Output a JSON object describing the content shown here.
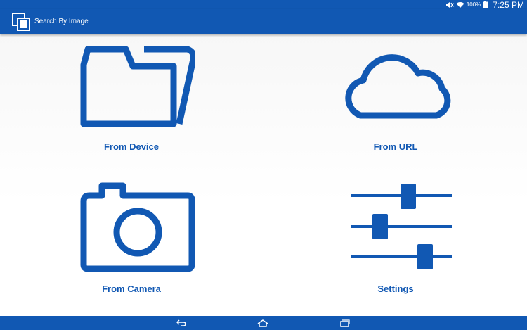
{
  "status_bar": {
    "battery_percent": "100%",
    "time": "7:25 PM",
    "icons": [
      "mute-icon",
      "wifi-icon",
      "battery-icon"
    ]
  },
  "app_bar": {
    "title": "Search By Image",
    "icon": "app-logo-icon"
  },
  "menu": [
    {
      "label": "From Device",
      "icon": "folder-icon"
    },
    {
      "label": "From URL",
      "icon": "cloud-icon"
    },
    {
      "label": "From Camera",
      "icon": "camera-icon"
    },
    {
      "label": "Settings",
      "icon": "sliders-icon"
    }
  ],
  "nav_bar": {
    "buttons": [
      "back-icon",
      "home-icon",
      "recents-icon"
    ]
  },
  "colors": {
    "primary": "#1158b3",
    "background": "#ffffff"
  }
}
